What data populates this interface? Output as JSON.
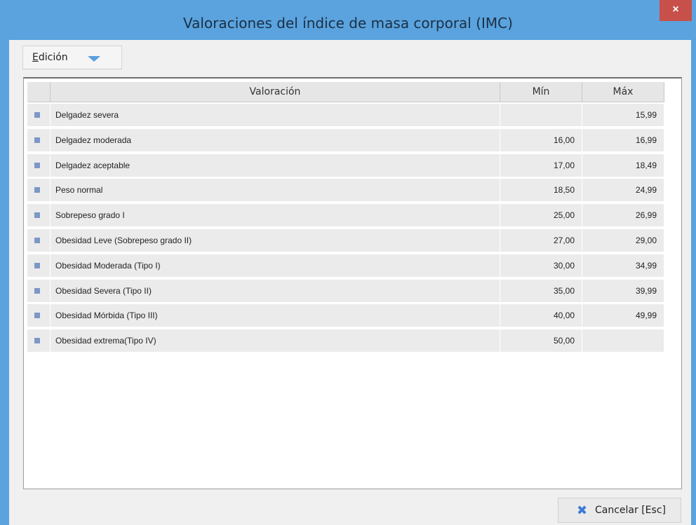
{
  "window": {
    "title": "Valoraciones del índice de masa corporal (IMC)",
    "close_label": "×"
  },
  "menu": {
    "edit_label": "Edición"
  },
  "table": {
    "columns": [
      "Valoración",
      "Mín",
      "Máx"
    ],
    "rows": [
      {
        "name": "Delgadez severa",
        "min": "",
        "max": "15,99"
      },
      {
        "name": "Delgadez moderada",
        "min": "16,00",
        "max": "16,99"
      },
      {
        "name": "Delgadez aceptable",
        "min": "17,00",
        "max": "18,49"
      },
      {
        "name": "Peso normal",
        "min": "18,50",
        "max": "24,99"
      },
      {
        "name": "Sobrepeso grado I",
        "min": "25,00",
        "max": "26,99"
      },
      {
        "name": "Obesidad Leve (Sobrepeso grado II)",
        "min": "27,00",
        "max": "29,00"
      },
      {
        "name": "Obesidad Moderada (Tipo I)",
        "min": "30,00",
        "max": "34,99"
      },
      {
        "name": "Obesidad Severa (Tipo II)",
        "min": "35,00",
        "max": "39,99"
      },
      {
        "name": "Obesidad Mórbida (Tipo III)",
        "min": "40,00",
        "max": "49,99"
      },
      {
        "name": "Obesidad extrema(Tipo IV)",
        "min": "50,00",
        "max": ""
      }
    ]
  },
  "footer": {
    "cancel_label": "Cancelar [Esc]",
    "cancel_icon": "close-x-icon"
  },
  "colors": {
    "titlebar": "#5aa3de",
    "close_button": "#c7504a",
    "row_marker": "#7d97c6"
  }
}
